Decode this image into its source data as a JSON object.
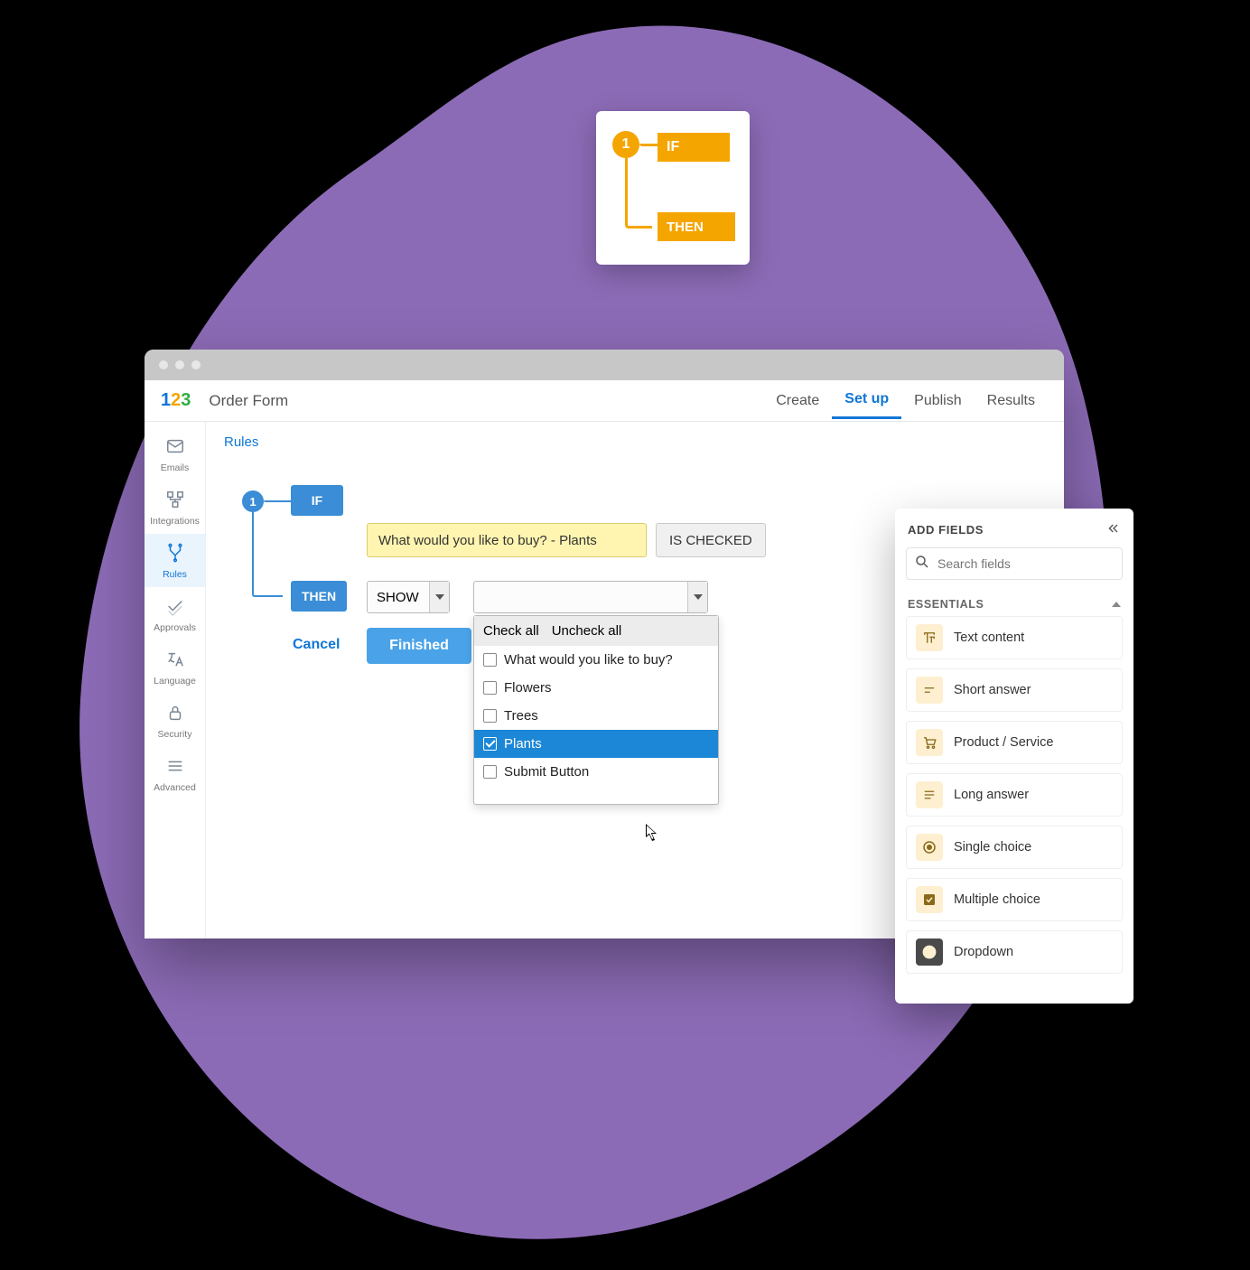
{
  "logic_card": {
    "num": "1",
    "if": "IF",
    "then": "THEN"
  },
  "topnav": {
    "form_title": "Order Form",
    "tabs": {
      "create": "Create",
      "setup": "Set up",
      "publish": "Publish",
      "results": "Results"
    }
  },
  "sidebar": {
    "emails": "Emails",
    "integrations": "Integrations",
    "rules": "Rules",
    "approvals": "Approvals",
    "language": "Language",
    "security": "Security",
    "advanced": "Advanced"
  },
  "breadcrumb": "Rules",
  "rule": {
    "num": "1",
    "if": "IF",
    "then": "THEN",
    "field": "What would you like to buy? - Plants",
    "operator": "IS CHECKED",
    "action": "SHOW",
    "cancel": "Cancel",
    "finished": "Finished"
  },
  "dropdown": {
    "check_all": "Check all",
    "uncheck_all": "Uncheck all",
    "items": {
      "0": "What would you like to buy?",
      "1": "Flowers",
      "2": "Trees",
      "3": "Plants",
      "4": "Submit Button"
    }
  },
  "fields_panel": {
    "title": "ADD FIELDS",
    "search_placeholder": "Search fields",
    "section": "ESSENTIALS",
    "items": {
      "text_content": "Text content",
      "short_answer": "Short answer",
      "product_service": "Product / Service",
      "long_answer": "Long answer",
      "single_choice": "Single choice",
      "multiple_choice": "Multiple choice",
      "dropdown": "Dropdown"
    }
  }
}
